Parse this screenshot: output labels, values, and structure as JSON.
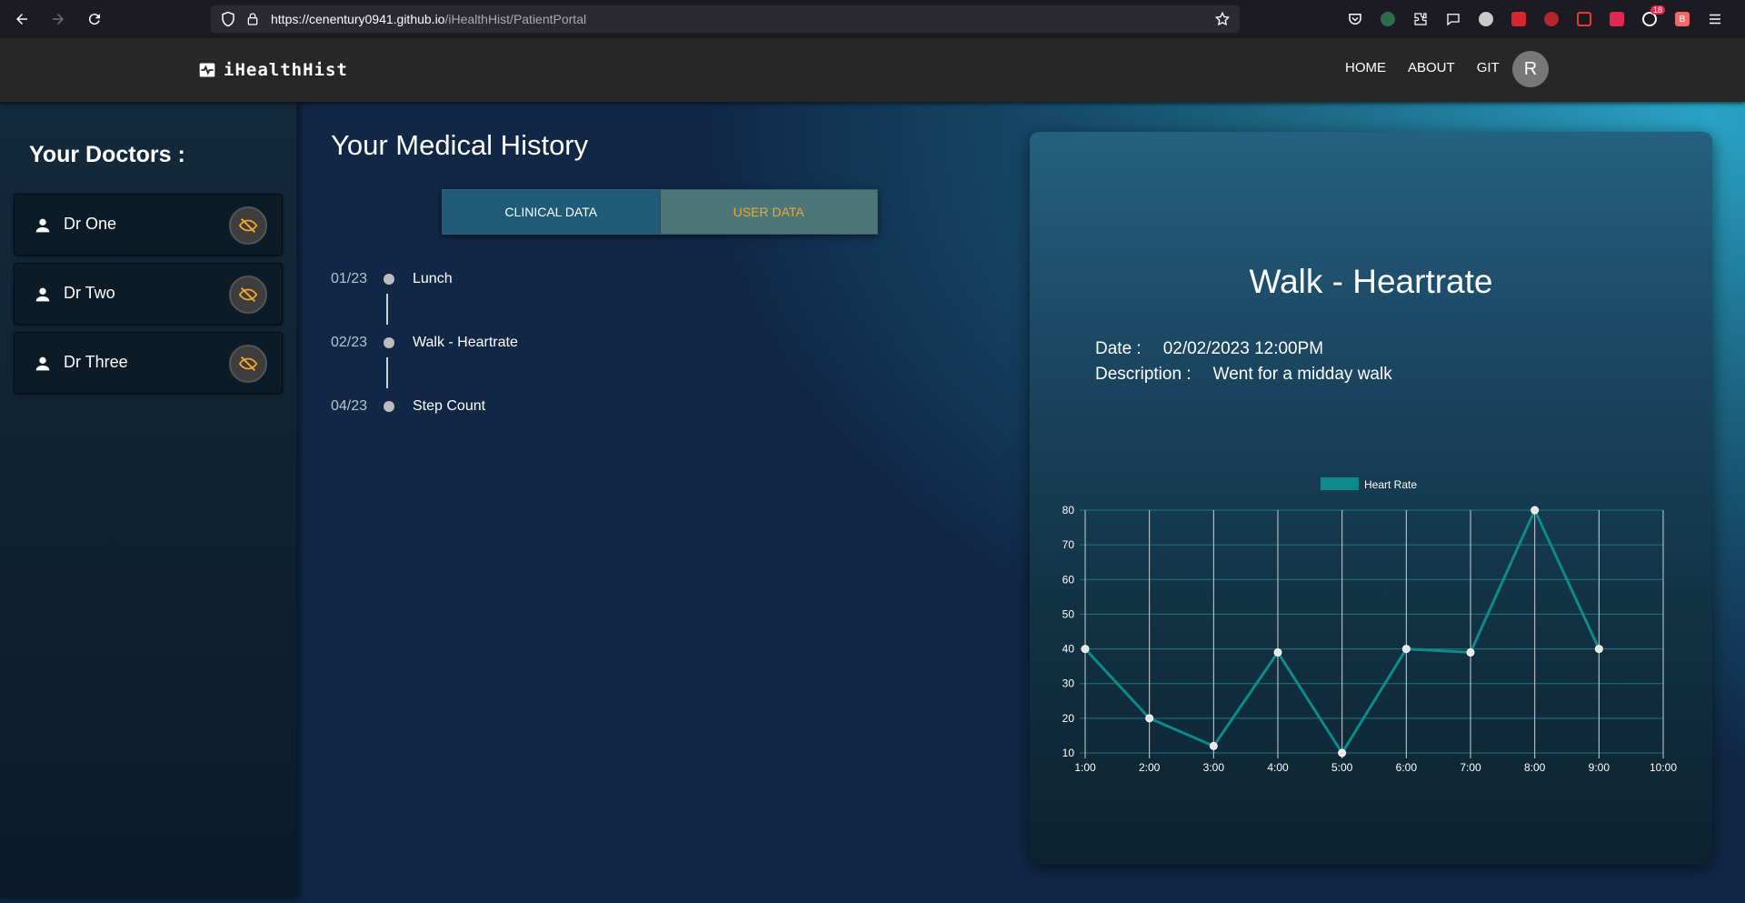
{
  "browser": {
    "url_host": "https://cenentury0941.github.io",
    "url_path": "/iHealthHist/PatientPortal",
    "extension_badge": "18",
    "extension_letter": "B"
  },
  "header": {
    "brand": "iHealthHist",
    "nav": [
      "HOME",
      "ABOUT",
      "GIT"
    ],
    "avatar_initial": "R"
  },
  "sidebar": {
    "title": "Your Doctors :",
    "doctors": [
      {
        "name": "Dr One"
      },
      {
        "name": "Dr Two"
      },
      {
        "name": "Dr Three"
      }
    ]
  },
  "history": {
    "title": "Your Medical History",
    "tabs": {
      "clinical": "CLINICAL DATA",
      "user": "USER DATA"
    },
    "entries": [
      {
        "date": "01/23",
        "label": "Lunch"
      },
      {
        "date": "02/23",
        "label": "Walk - Heartrate"
      },
      {
        "date": "04/23",
        "label": "Step Count"
      }
    ]
  },
  "detail": {
    "title": "Walk - Heartrate",
    "date_label": "Date :",
    "date_value": "02/02/2023 12:00PM",
    "desc_label": "Description :",
    "desc_value": "Went for a midday walk"
  },
  "chart_data": {
    "type": "line",
    "x": [
      "1:00",
      "2:00",
      "3:00",
      "4:00",
      "5:00",
      "6:00",
      "7:00",
      "8:00",
      "9:00",
      "10:00"
    ],
    "series": [
      {
        "name": "Heart Rate",
        "values": [
          40,
          20,
          12,
          39,
          10,
          40,
          39,
          80,
          40,
          null
        ]
      }
    ],
    "ylim": [
      10,
      80
    ],
    "yticks": [
      10,
      20,
      30,
      40,
      50,
      60,
      70,
      80
    ],
    "grid": true,
    "legend": "top",
    "line_color": "#0f8a8a",
    "point_color": "#e6e6e6"
  },
  "colors": {
    "accent": "#f0a830",
    "tab_clinical": "#1f5b78",
    "tab_user": "#4d7679"
  }
}
